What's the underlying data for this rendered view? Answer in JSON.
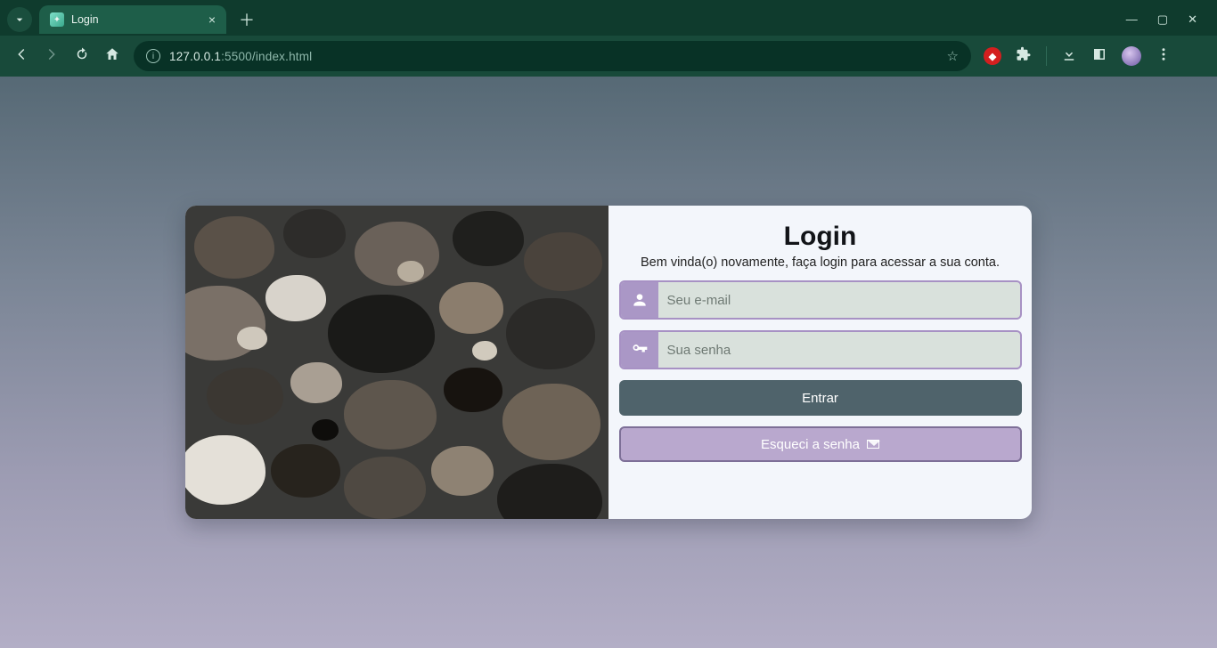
{
  "browser": {
    "tab_title": "Login",
    "url_host": "127.0.0.1",
    "url_port": ":5500",
    "url_path": "/index.html"
  },
  "login": {
    "title": "Login",
    "subtitle": "Bem vinda(o) novamente, faça login para acessar a sua conta.",
    "email_placeholder": "Seu e-mail",
    "email_value": "",
    "password_placeholder": "Sua senha",
    "password_value": "",
    "submit_label": "Entrar",
    "forgot_label": "Esqueci a senha"
  },
  "colors": {
    "chrome_bg": "#184a3a",
    "field_border": "#a791c4",
    "field_icon_bg": "#aa97c6",
    "primary_btn": "#4f636b",
    "secondary_btn": "#b9a8ce"
  }
}
